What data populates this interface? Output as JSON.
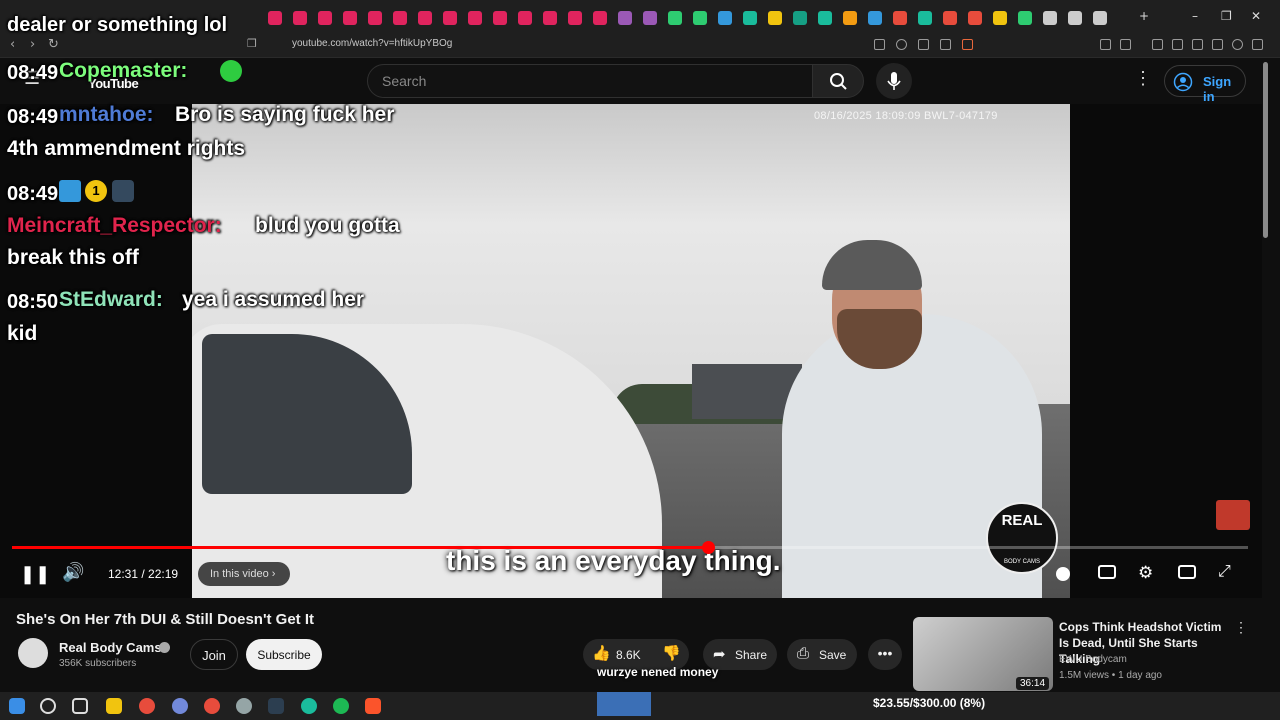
{
  "browser": {
    "url": "youtube.com/watch?v=hftikUpYBOg",
    "tab_colors": [
      "#e0245e",
      "#e0245e",
      "#e0245e",
      "#e0245e",
      "#e0245e",
      "#e0245e",
      "#e0245e",
      "#e0245e",
      "#e0245e",
      "#e0245e",
      "#e0245e",
      "#e0245e",
      "#e0245e",
      "#e0245e",
      "#9b59b6",
      "#9b59b6",
      "#2ecc71",
      "#2ecc71",
      "#3498db",
      "#1abc9c",
      "#f1c40f",
      "#16a085",
      "#1abc9c",
      "#f39c12",
      "#3498db",
      "#e74c3c",
      "#1abc9c",
      "#e74c3c",
      "#e74c3c",
      "#f1c40f",
      "#2ecc71",
      "#cccccc",
      "#cccccc",
      "#cccccc"
    ],
    "new_tab": "+",
    "window_controls": [
      "–",
      "❐",
      "✕"
    ]
  },
  "youtube": {
    "search_placeholder": "Search",
    "sign_in": "Sign in",
    "logo_text": "YouTube"
  },
  "video": {
    "osd_text": "08/16/2025 18:09:09      BWL7-047179",
    "caption": "this is an everyday thing.",
    "brand_badge_top": "REAL",
    "brand_badge_bottom": "BODY CAMS",
    "progress": 0.563,
    "time": "12:31 / 22:19",
    "chapter_label": "In this video",
    "title": "She's On Her 7th DUI & Still Doesn't Get It"
  },
  "channel": {
    "name": "Real Body Cams",
    "subscribers": "356K subscribers",
    "join": "Join",
    "subscribe": "Subscribe"
  },
  "actions": {
    "likes": "8.6K",
    "share": "Share",
    "save": "Save",
    "more": "•••"
  },
  "recommendation": {
    "title": "Cops Think Headshot Victim Is Dead, Until She Starts Talking",
    "channel": "EWU Bodycam",
    "meta": "1.5M views • 1 day ago",
    "duration": "36:14"
  },
  "chat": {
    "top_fragment": "dealer or something lol",
    "messages": [
      {
        "time": "08:49",
        "user": "Copemaster:",
        "user_color": "#7cfc7c",
        "text": ""
      },
      {
        "time": "08:49",
        "user": "mntahoe:",
        "user_color": "#4f7bd6",
        "text": "Bro is saying fuck her",
        "cont": "4th ammendment rights"
      },
      {
        "time": "08:49",
        "user": "",
        "user_color": "#ffffff",
        "text": ""
      },
      {
        "time": "",
        "user": "Meincraft_Respector:",
        "user_color": "#e0244c",
        "text": "blud you gotta",
        "cont": "break this off"
      },
      {
        "time": "08:50",
        "user": "StEdward:",
        "user_color": "#8fe3b8",
        "text": "yea i assumed her",
        "cont": "kid"
      }
    ],
    "badge_number": "1"
  },
  "stream_overlay": {
    "donation_message": "wurzye nened money",
    "donation_goal": "$23.55/$300.00 (8%)"
  }
}
